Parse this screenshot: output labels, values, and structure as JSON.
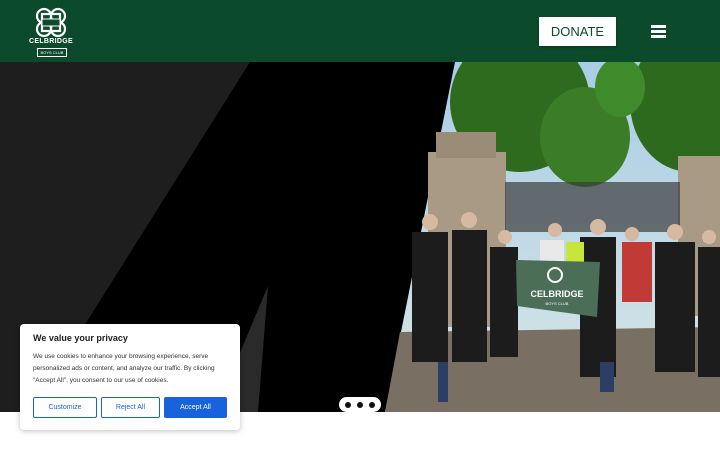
{
  "header": {
    "logo_name": "CELBRIDGE",
    "logo_sub": "BOYS CLUB",
    "donate_label": "DONATE",
    "menu_icon": "hamburger-menu-icon"
  },
  "hero": {
    "banner_name": "CELBRIDGE",
    "banner_sub": "BOYS CLUB",
    "slider_dots": 3
  },
  "cookie_banner": {
    "title": "We value your privacy",
    "body": "We use cookies to enhance your browsing experience, serve personalized ads or content, and analyze our traffic. By clicking \"Accept All\", you consent to our use of cookies.",
    "customize_label": "Customize",
    "reject_label": "Reject All",
    "accept_label": "Accept All"
  },
  "colors": {
    "header_bg": "#0b4a2b",
    "accept_blue": "#1863dc"
  }
}
